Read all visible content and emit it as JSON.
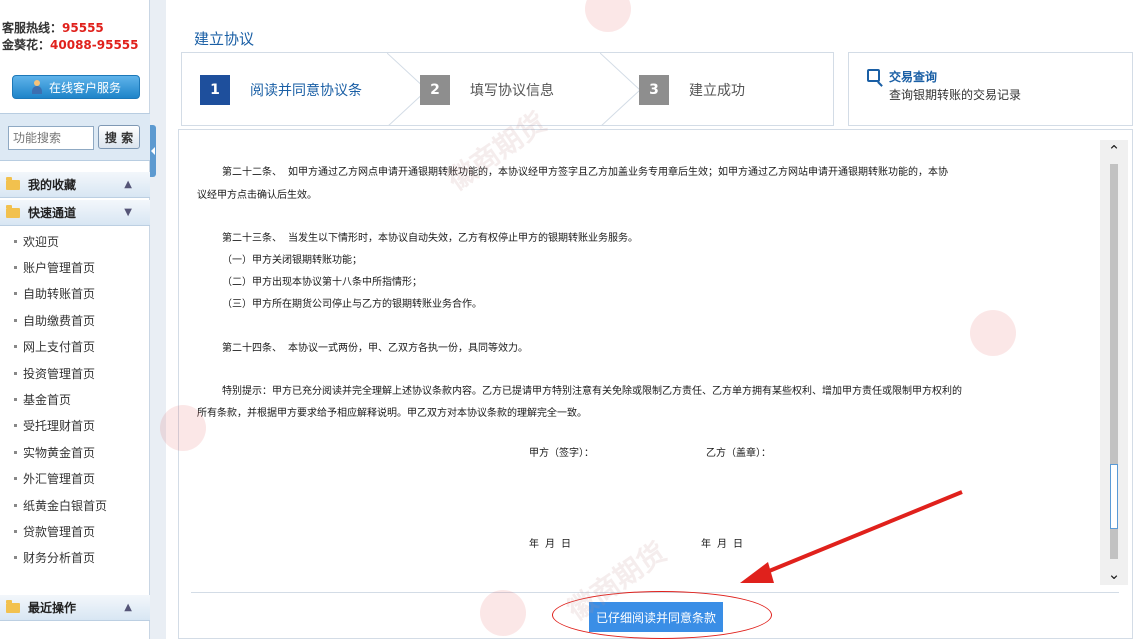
{
  "sidebar": {
    "hotline_label": "客服热线：",
    "hotline_number": "95555",
    "jinkuihua_label": "金葵花：",
    "jinkuihua_number": "40088-95555",
    "online_service": "在线客户服务",
    "search_placeholder": "功能搜索",
    "search_button": "搜 索",
    "groups": {
      "favorites": "我的收藏",
      "quick": "快速通道",
      "recent": "最近操作"
    },
    "items": [
      "欢迎页",
      "账户管理首页",
      "自助转账首页",
      "自助缴费首页",
      "网上支付首页",
      "投资管理首页",
      "基金首页",
      "受托理财首页",
      "实物黄金首页",
      "外汇管理首页",
      "纸黄金白银首页",
      "贷款管理首页",
      "财务分析首页"
    ]
  },
  "main": {
    "title": "建立协议",
    "steps": [
      {
        "num": "1",
        "label": "阅读并同意协议条",
        "active": true
      },
      {
        "num": "2",
        "label": "填写协议信息",
        "active": false
      },
      {
        "num": "3",
        "label": "建立成功",
        "active": false
      }
    ],
    "query": {
      "title": "交易查询",
      "desc": "查询银期转账的交易记录"
    },
    "agreement": {
      "p22a": "第二十二条、    如甲方通过乙方网点申请开通银期转账功能的，本协议经甲方签字且乙方加盖业务专用章后生效；如甲方通过乙方网站申请开通银期转账功能的，本协",
      "p22b": "议经甲方点击确认后生效。",
      "p23": "第二十三条、    当发生以下情形时，本协议自动失效，乙方有权停止甲方的银期转账业务服务。",
      "p23_1": "（一）甲方关闭银期转账功能；",
      "p23_2": "（二）甲方出现本协议第十八条中所指情形；",
      "p23_3": "（三）甲方所在期货公司停止与乙方的银期转账业务合作。",
      "p24": "第二十四条、    本协议一式两份，甲、乙双方各执一份，具同等效力。",
      "notice_a": "特别提示：甲方已充分阅读并完全理解上述协议条款内容。乙方已提请甲方特别注意有关免除或限制乙方责任、乙方单方拥有某些权利、增加甲方责任或限制甲方权利的",
      "notice_b": "所有条款，并根据甲方要求给予相应解释说明。甲乙双方对本协议条款的理解完全一致。",
      "party_a": "甲方（签字）：",
      "party_b": "乙方（盖章）：",
      "date_a": "年   月   日",
      "date_b": "年   月   日"
    },
    "agree_button": "已仔细阅读并同意条款"
  },
  "watermark": {
    "cn": "徽商期货",
    "en": "HUISHANG FUTURES"
  },
  "colors": {
    "accent_blue": "#1a5fa5",
    "step_active": "#1e4f9c",
    "step_inactive": "#8e8e8e",
    "alert_red": "#e0211c",
    "button_blue": "#3a8ee6"
  }
}
